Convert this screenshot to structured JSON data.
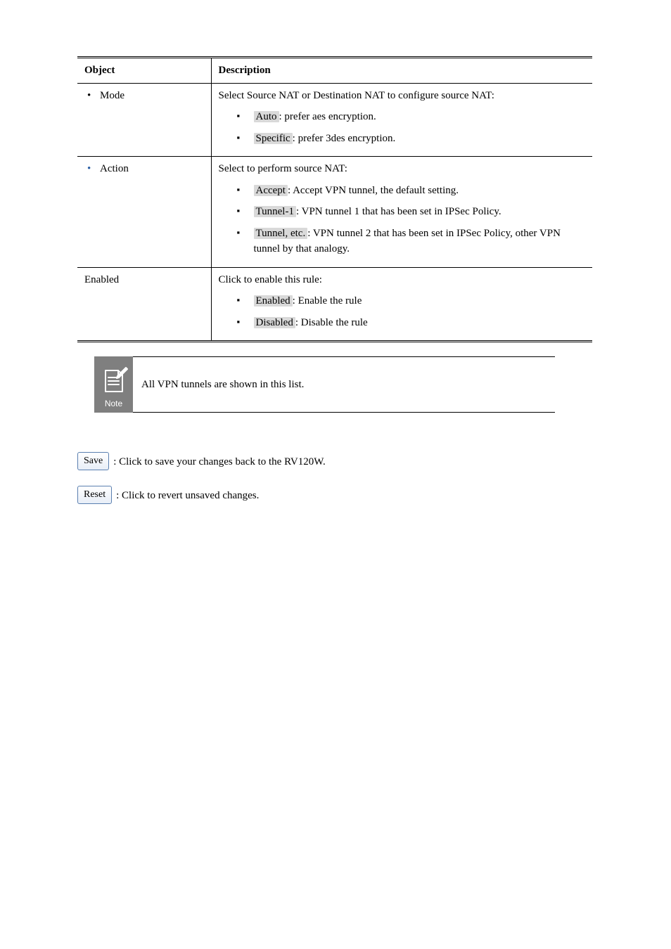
{
  "tableHeader": {
    "left": "Object",
    "right": "Description"
  },
  "row1": {
    "leftBullet": "Mode",
    "intro": "Select Source NAT or Destination NAT to configure source NAT:",
    "items": [
      {
        "highlight": "Auto",
        "text": ": prefer aes encryption."
      },
      {
        "highlight": "Specific",
        "text": ": prefer 3des encryption."
      }
    ]
  },
  "row2": {
    "leftBullet": "Action",
    "intro": "Select to perform source NAT:",
    "items": [
      {
        "highlight": "Accept",
        "text": ": Accept VPN tunnel, the default setting."
      },
      {
        "highlight": "Tunnel-1",
        "text": ": VPN tunnel 1 that has been set in IPSec Policy."
      },
      {
        "highlight": "Tunnel, etc.",
        "text": ": VPN tunnel 2 that has been set in IPSec Policy, other VPN tunnel by that analogy."
      }
    ]
  },
  "row3": {
    "left": "Enabled",
    "intro": "Click to enable this rule:",
    "items": [
      {
        "highlight": "Enabled",
        "text": ": Enable the rule"
      },
      {
        "highlight": "Disabled",
        "text": ": Disable the rule"
      }
    ]
  },
  "note": "All VPN tunnels are shown in this list.",
  "buttons": {
    "save": {
      "label": "Save",
      "desc": ": Click to save your changes back to the RV120W."
    },
    "reset": {
      "label": "Reset",
      "desc": ": Click to revert unsaved changes."
    }
  }
}
